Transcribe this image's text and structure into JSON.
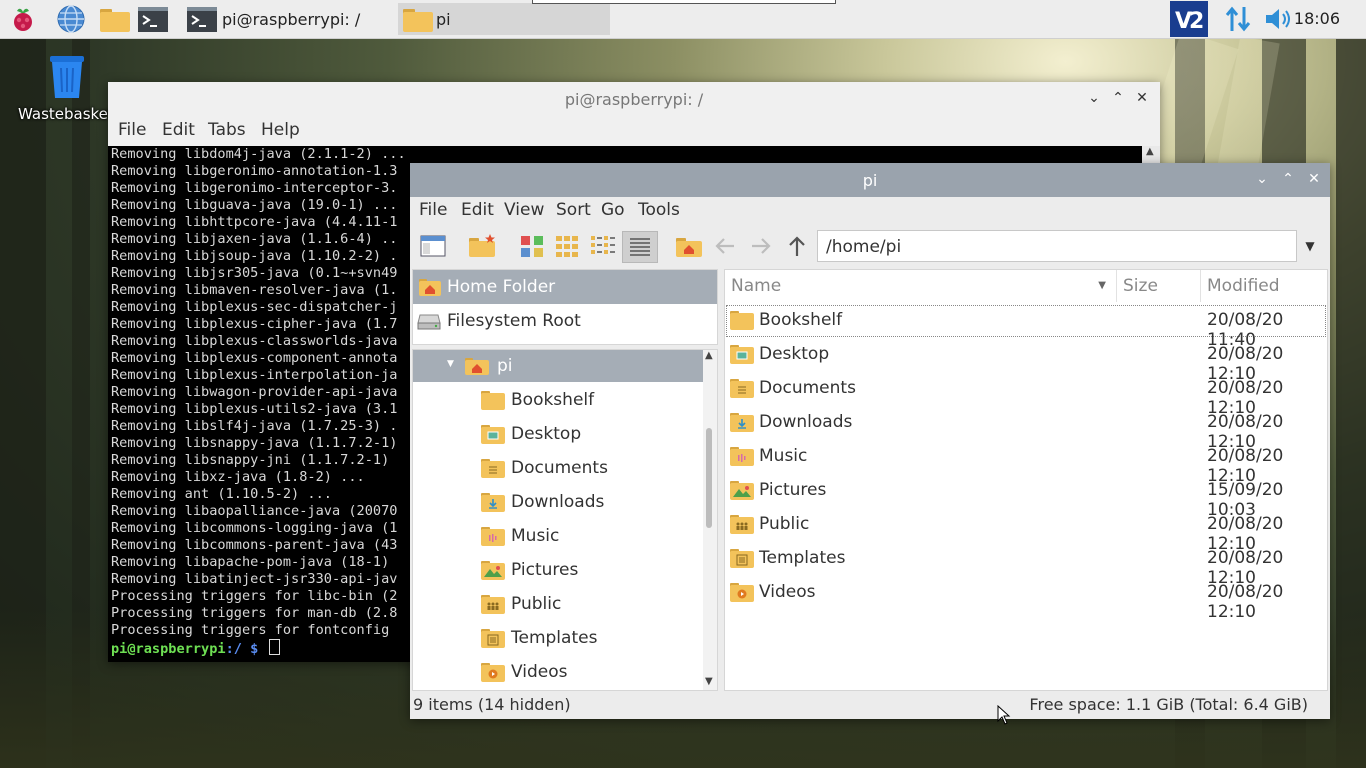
{
  "taskbar": {
    "tasks": [
      {
        "label": "pi@raspberrypi: /",
        "icon": "terminal-icon"
      },
      {
        "label": "pi",
        "icon": "folder-icon"
      }
    ],
    "clock": "18:06"
  },
  "desktop": {
    "icons": [
      {
        "label": "Wastebasket",
        "icon": "trash-icon"
      }
    ]
  },
  "terminal": {
    "title": "pi@raspberrypi: /",
    "menu": [
      "File",
      "Edit",
      "Tabs",
      "Help"
    ],
    "lines": [
      "Removing libdom4j-java (2.1.1-2) ...",
      "Removing libgeronimo-annotation-1.3",
      "Removing libgeronimo-interceptor-3.",
      "Removing libguava-java (19.0-1) ...",
      "Removing libhttpcore-java (4.4.11-1",
      "Removing libjaxen-java (1.1.6-4) ..",
      "Removing libjsoup-java (1.10.2-2) .",
      "Removing libjsr305-java (0.1~+svn49",
      "Removing libmaven-resolver-java (1.",
      "Removing libplexus-sec-dispatcher-j",
      "Removing libplexus-cipher-java (1.7",
      "Removing libplexus-classworlds-java",
      "Removing libplexus-component-annota",
      "Removing libplexus-interpolation-ja",
      "Removing libwagon-provider-api-java",
      "Removing libplexus-utils2-java (3.1",
      "Removing libslf4j-java (1.7.25-3) .",
      "Removing libsnappy-java (1.1.7.2-1)",
      "Removing libsnappy-jni (1.1.7.2-1)",
      "Removing libxz-java (1.8-2) ...",
      "Removing ant (1.10.5-2) ...",
      "Removing libaopalliance-java (20070",
      "Removing libcommons-logging-java (1",
      "Removing libcommons-parent-java (43",
      "Removing libapache-pom-java (18-1)",
      "Removing libatinject-jsr330-api-jav",
      "Processing triggers for libc-bin (2",
      "Processing triggers for man-db (2.8",
      "Processing triggers for fontconfig"
    ],
    "prompt_user": "pi@raspberrypi",
    "prompt_path": ":/ $"
  },
  "filemanager": {
    "title": "pi",
    "menu": [
      "File",
      "Edit",
      "View",
      "Sort",
      "Go",
      "Tools"
    ],
    "path": "/home/pi",
    "places": [
      {
        "label": "Home Folder",
        "icon": "home-icon",
        "selected": true
      },
      {
        "label": "Filesystem Root",
        "icon": "drive-icon",
        "selected": false
      }
    ],
    "tree_root": "pi",
    "tree_children": [
      "Bookshelf",
      "Desktop",
      "Documents",
      "Downloads",
      "Music",
      "Pictures",
      "Public",
      "Templates",
      "Videos"
    ],
    "columns": {
      "name": "Name",
      "size": "Size",
      "modified": "Modified"
    },
    "files": [
      {
        "name": "Bookshelf",
        "modified": "20/08/20 11:40",
        "icon": "folder-icon"
      },
      {
        "name": "Desktop",
        "modified": "20/08/20 12:10",
        "icon": "desktop-folder-icon"
      },
      {
        "name": "Documents",
        "modified": "20/08/20 12:10",
        "icon": "documents-folder-icon"
      },
      {
        "name": "Downloads",
        "modified": "20/08/20 12:10",
        "icon": "downloads-folder-icon"
      },
      {
        "name": "Music",
        "modified": "20/08/20 12:10",
        "icon": "music-folder-icon"
      },
      {
        "name": "Pictures",
        "modified": "15/09/20 10:03",
        "icon": "pictures-folder-icon"
      },
      {
        "name": "Public",
        "modified": "20/08/20 12:10",
        "icon": "public-folder-icon"
      },
      {
        "name": "Templates",
        "modified": "20/08/20 12:10",
        "icon": "templates-folder-icon"
      },
      {
        "name": "Videos",
        "modified": "20/08/20 12:10",
        "icon": "videos-folder-icon"
      }
    ],
    "status_left": "9 items (14 hidden)",
    "status_right": "Free space: 1.1 GiB (Total: 6.4 GiB)"
  }
}
